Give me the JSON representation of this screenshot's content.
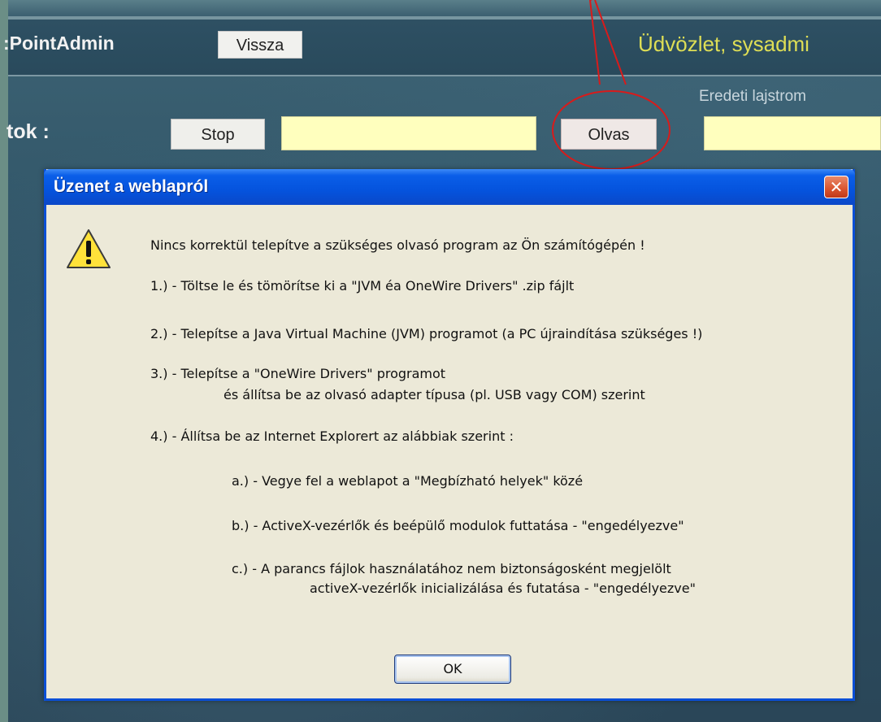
{
  "header": {
    "app_title": ":PointAdmin",
    "back_label": "Vissza",
    "greeting": "Üdvözlet, sysadmi"
  },
  "reader_row": {
    "label": "tok :",
    "stop_label": "Stop",
    "input_1_value": "",
    "read_label": "Olvas",
    "original_register_label": "Eredeti lajstrom",
    "input_2_value": ""
  },
  "dialog": {
    "title": "Üzenet a weblapról",
    "close_glyph": "✕",
    "icon": "warning-icon",
    "lines": [
      "Nincs korrektül telepítve a szükséges olvasó program az Ön számítógépén !",
      "1.) - Töltse le és tömörítse ki a \"JVM éa OneWire Drivers\" .zip fájlt",
      "2.) - Telepítse a Java Virtual Machine (JVM) programot (a PC újraindítása szükséges !)",
      "3.) - Telepítse a \"OneWire Drivers\" programot",
      "és állítsa be az olvasó adapter típusa (pl. USB vagy COM) szerint",
      "4.) - Állítsa be az Internet Explorert az alábbiak szerint :",
      "a.) - Vegye fel a weblapot a \"Megbízható helyek\" közé",
      "b.) - ActiveX-vezérlők és beépülő modulok futtatása - \"engedélyezve\"",
      "c.) - A parancs fájlok használatához nem biztonságosként megjelölt",
      "activeX-vezérlők inicializálása és futatása - \"engedélyezve\""
    ],
    "ok_label": "OK"
  },
  "colors": {
    "titlebar": "#0553dd",
    "dialog_bg": "#ece9d8",
    "input_bg": "#ffffbe",
    "greeting": "#dede55",
    "annotation": "#d81b1b"
  }
}
